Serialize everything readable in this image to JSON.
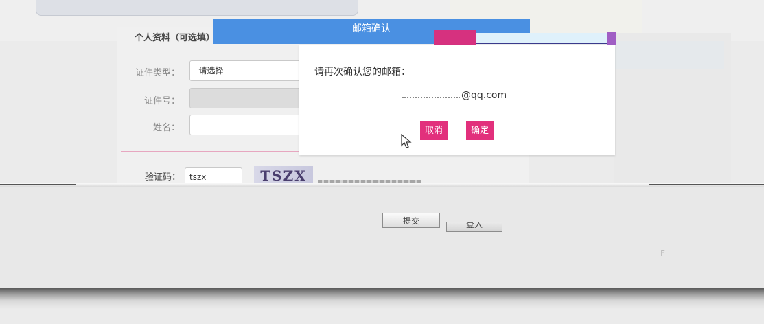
{
  "dialog": {
    "title": "邮箱确认",
    "prompt": "请再次确认您的邮箱：",
    "email_domain": "@qq.com",
    "cancel_label": "取消",
    "confirm_label": "确定",
    "accent_color": "#e2307c",
    "header_color": "#4a90e2"
  },
  "form": {
    "section_title": "个人资料（可选填）",
    "id_type_label": "证件类型：",
    "id_type_value": "-请选择-",
    "id_number_label": "证件号：",
    "name_label": "姓名：",
    "captcha_label": "验证码：",
    "captcha_value": "tszx",
    "captcha_image_text": "TSZX"
  },
  "actions": {
    "submit_label": "提交",
    "login_label": "登入"
  },
  "page": {
    "corner_char": "F"
  }
}
